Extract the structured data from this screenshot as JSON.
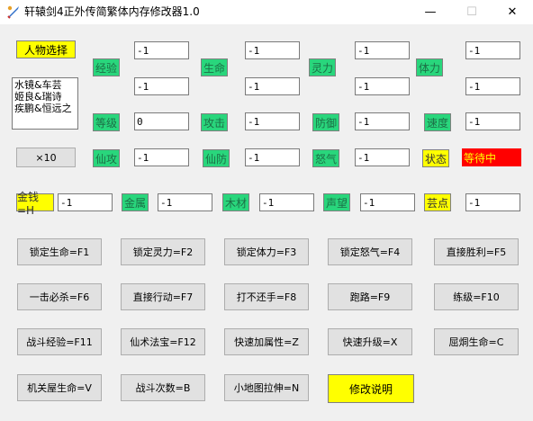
{
  "window": {
    "title": "轩辕剑4正外传简繁体内存修改器1.0",
    "minimize_glyph": "—",
    "maximize_glyph": "☐",
    "close_glyph": "✕",
    "icon": "sword-icon"
  },
  "left_panel": {
    "select_character_label": "人物选择",
    "characters": [
      "水镜&车芸",
      "姬良&瑞诗",
      "疾鹏&恒远之"
    ],
    "times_ten_label": "×10"
  },
  "labels": {
    "exp": "经验",
    "hp": "生命",
    "mp": "灵力",
    "stamina": "体力",
    "level": "等级",
    "attack": "攻击",
    "defense": "防御",
    "speed": "速度",
    "magic_attack": "仙攻",
    "magic_defense": "仙防",
    "rage": "怒气",
    "state": "状态",
    "money": "金钱=H",
    "gold": "金属",
    "wood": "木材",
    "fame": "声望",
    "cloud_points": "芸点"
  },
  "values": {
    "exp_current": "-1",
    "exp_max": "-1",
    "hp_current": "-1",
    "hp_max": "-1",
    "mp_current": "-1",
    "mp_max": "-1",
    "stamina_current": "-1",
    "stamina_max": "-1",
    "level": "0",
    "attack": "-1",
    "defense": "-1",
    "speed": "-1",
    "magic_attack": "-1",
    "magic_defense": "-1",
    "rage": "-1",
    "money": "-1",
    "gold": "-1",
    "wood": "-1",
    "fame": "-1",
    "cloud_points": "-1"
  },
  "status_text": "等待中",
  "buttons": {
    "lock_hp": "锁定生命=F1",
    "lock_mp": "锁定灵力=F2",
    "lock_stamina": "锁定体力=F3",
    "lock_rage": "锁定怒气=F4",
    "instant_win": "直接胜利=F5",
    "one_hit_kill": "一击必杀=F6",
    "direct_action": "直接行动=F7",
    "no_counter": "打不还手=F8",
    "run_away": "跑路=F9",
    "train_level": "练级=F10",
    "battle_exp": "战斗经验=F11",
    "immortal_treasure": "仙术法宝=F12",
    "fast_attr": "快速加属性=Z",
    "fast_levelup": "快速升级=X",
    "bend_life": "屈烔生命=C",
    "mech_house_life": "机关屋生命=V",
    "battle_count": "战斗次数=B",
    "minimap_stretch": "小地图拉伸=N",
    "edit_help": "修改说明"
  },
  "colors": {
    "accent_yellow": "#ffff00",
    "label_green": "#29d67c",
    "status_red": "#ff0000"
  }
}
